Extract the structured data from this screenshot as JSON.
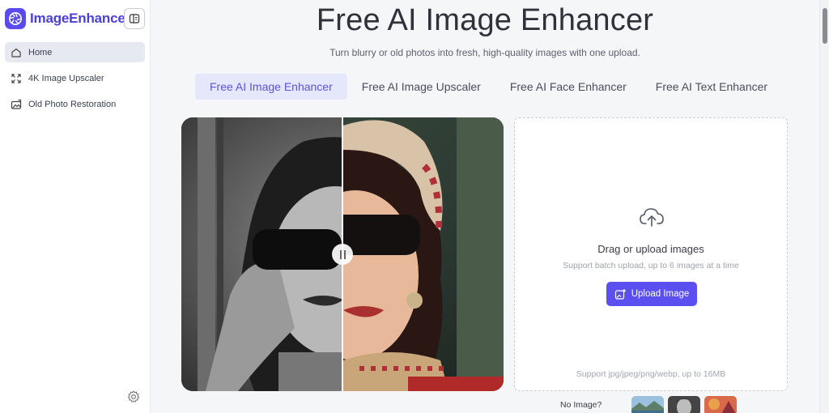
{
  "sidebar": {
    "logo_text": "ImageEnhancer",
    "items": [
      {
        "label": "Home",
        "icon": "home-icon",
        "active": true
      },
      {
        "label": "4K Image Upscaler",
        "icon": "expand-icon",
        "active": false
      },
      {
        "label": "Old Photo Restoration",
        "icon": "photo-restore-icon",
        "active": false
      }
    ]
  },
  "main": {
    "title": "Free AI Image Enhancer",
    "subtitle": "Turn blurry or old photos into fresh, high-quality images with one upload.",
    "tabs": [
      {
        "label": "Free AI Image Enhancer",
        "active": true
      },
      {
        "label": "Free AI Image Upscaler",
        "active": false
      },
      {
        "label": "Free AI Face Enhancer",
        "active": false
      },
      {
        "label": "Free AI Text Enhancer",
        "active": false
      }
    ]
  },
  "upload": {
    "drag_text": "Drag or upload images",
    "batch_text": "Support batch upload, up to 6 images at a time",
    "button_label": "Upload Image",
    "support_text": "Support jpg/jpeg/png/webp, up to 16MB"
  },
  "samples": {
    "label": "No Image?"
  },
  "colors": {
    "accent": "#5b4ff0",
    "logo": "#4b40d8",
    "active_tab_bg": "#e5e7fa"
  }
}
